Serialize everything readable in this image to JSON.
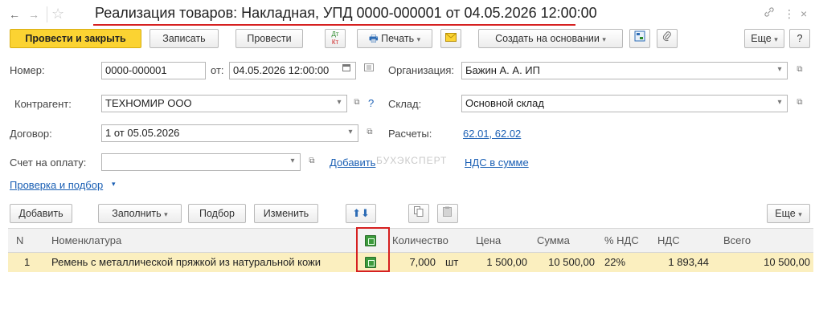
{
  "window": {
    "title": "Реализация товаров: Накладная, УПД 0000-000001 от 04.05.2026 12:00:00",
    "back_icon": "←",
    "forward_icon": "→",
    "link_icon": "🔗",
    "more_icon": "⋮",
    "close_icon": "×"
  },
  "toolbar": {
    "post_close": "Провести и закрыть",
    "save": "Записать",
    "post": "Провести",
    "dt_kt": "Дт Кт",
    "print": "Печать",
    "create_based": "Создать на основании",
    "more": "Еще",
    "help": "?"
  },
  "form": {
    "number_label": "Номер:",
    "number_value": "0000-000001",
    "date_label": "от:",
    "date_value": "04.05.2026 12:00:00",
    "org_label": "Организация:",
    "org_value": "Бажин А. А. ИП",
    "contractor_label": "Контрагент:",
    "contractor_value": "ТЕХНОМИР ООО",
    "help_mark": "?",
    "warehouse_label": "Склад:",
    "warehouse_value": "Основной склад",
    "contract_label": "Договор:",
    "contract_value": "1 от 05.05.2026",
    "settlements_label": "Расчеты:",
    "settlements_link": "62.01, 62.02",
    "invoice_label": "Счет на оплату:",
    "invoice_value": "",
    "add_link": "Добавить",
    "vat_link": "НДС в сумме",
    "check_link": "Проверка и подбор",
    "watermark": "БУХЭКСПЕРТ"
  },
  "table_toolbar": {
    "add": "Добавить",
    "fill": "Заполнить",
    "select": "Подбор",
    "change": "Изменить",
    "more": "Еще"
  },
  "table": {
    "headers": {
      "n": "N",
      "item": "Номенклатура",
      "qty": "Количество",
      "price": "Цена",
      "sum": "Сумма",
      "vat_rate": "% НДС",
      "vat": "НДС",
      "total": "Всего"
    },
    "rows": [
      {
        "n": "1",
        "item": "Ремень с металлической пряжкой из натуральной кожи",
        "qty": "7,000",
        "unit": "шт",
        "price": "1 500,00",
        "sum": "10 500,00",
        "vat_rate": "22%",
        "vat": "1 893,44",
        "total": "10 500,00"
      }
    ]
  },
  "colors": {
    "accent_yellow": "#fbd332",
    "row_highlight": "#fbefbf",
    "annotation_red": "#d62020",
    "link_blue": "#1a5fb4"
  }
}
